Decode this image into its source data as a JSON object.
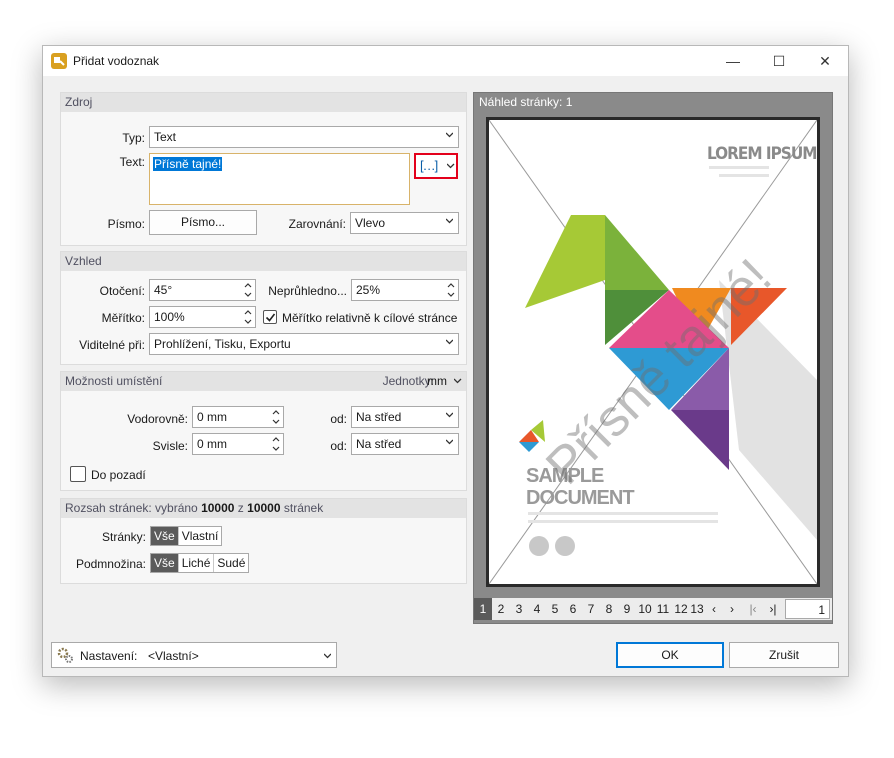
{
  "window": {
    "title": "Přidat vodoznak"
  },
  "source": {
    "heading": "Zdroj",
    "type_label": "Typ:",
    "type_value": "Text",
    "text_label": "Text:",
    "text_value": "Přísně tajné!",
    "font_label": "Písmo:",
    "font_button": "Písmo...",
    "align_label": "Zarovnání:",
    "align_value": "Vlevo"
  },
  "appearance": {
    "heading": "Vzhled",
    "rotation_label": "Otočení:",
    "rotation_value": "45°",
    "opacity_label": "Neprůhledno...",
    "opacity_value": "25%",
    "scale_label": "Měřítko:",
    "scale_value": "100%",
    "relative_scale_label": "Měřítko relativně k cílové stránce",
    "relative_scale_checked": true,
    "visible_label": "Viditelné při:",
    "visible_value": "Prohlížení, Tisku, Exportu"
  },
  "placement": {
    "heading": "Možnosti umístění",
    "units_label": "Jednotky:",
    "units_value": "mm",
    "horizontal_label": "Vodorovně:",
    "horizontal_value": "0 mm",
    "from_label": "od:",
    "horizontal_from": "Na střed",
    "vertical_label": "Svisle:",
    "vertical_value": "0 mm",
    "vertical_from": "Na střed",
    "background_label": "Do pozadí",
    "background_checked": false
  },
  "range": {
    "heading_prefix": "Rozsah stránek: vybráno",
    "selected": "10000",
    "of_word": "z",
    "total": "10000",
    "heading_suffix": "stránek",
    "pages_label": "Stránky:",
    "pages_options": [
      "Vše",
      "Vlastní"
    ],
    "subset_label": "Podmnožina:",
    "subset_options": [
      "Vše",
      "Liché",
      "Sudé"
    ]
  },
  "preview": {
    "heading": "Náhled stránky: 1",
    "doc_title": "LOREM IPSUM",
    "doc_sample": "SAMPLE",
    "doc_document": "DOCUMENT",
    "watermark_text": "Přísně tajné!",
    "pages": [
      "1",
      "2",
      "3",
      "4",
      "5",
      "6",
      "7",
      "8",
      "9",
      "10",
      "11",
      "12",
      "13"
    ],
    "current_page": "1"
  },
  "footer": {
    "settings_label": "Nastavení:",
    "settings_value": "<Vlastní>",
    "ok": "OK",
    "cancel": "Zrušit"
  },
  "colors": {
    "accent": "#e3001b",
    "selection": "#0078d7",
    "focus_border": "#d8b36a"
  },
  "icons": [
    "app-icon",
    "minimize-icon",
    "maximize-icon",
    "close-icon",
    "chevron-down-icon",
    "spinner-icon",
    "gear-icon",
    "prev-icon",
    "next-icon",
    "first-icon",
    "last-icon",
    "ellipsis-icon"
  ]
}
